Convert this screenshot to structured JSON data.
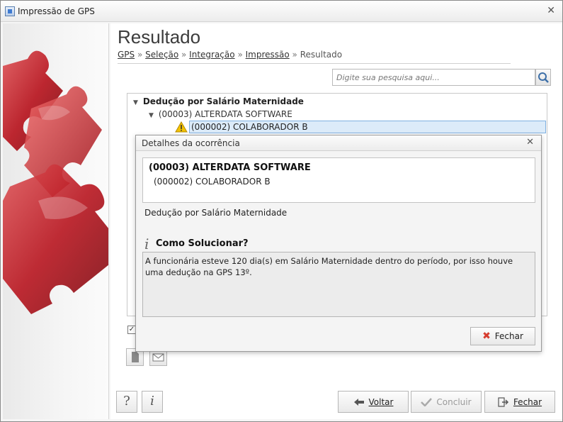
{
  "window": {
    "title": "Impressão de GPS",
    "close_glyph": "✕"
  },
  "header": {
    "title": "Resultado",
    "breadcrumb": [
      {
        "label": "GPS",
        "link": true
      },
      {
        "label": "Seleção",
        "link": true
      },
      {
        "label": "Integração",
        "link": true
      },
      {
        "label": "Impressão",
        "link": true
      },
      {
        "label": "Resultado",
        "link": false
      }
    ],
    "separator": "»"
  },
  "search": {
    "placeholder": "Digite sua pesquisa aqui...",
    "value": "",
    "icon": "search-icon"
  },
  "tree": {
    "group": "Dedução por Salário Maternidade",
    "company": "(00003) ALTERDATA SOFTWARE",
    "employee": "(000002) COLABORADOR B"
  },
  "dialog": {
    "title": "Detalhes da ocorrência",
    "company": "(00003) ALTERDATA SOFTWARE",
    "employee": "(000002) COLABORADOR B",
    "description": "Dedução por Salário Maternidade",
    "solve_title": "Como Solucionar?",
    "solve_text": "A funcionária esteve 120 dia(s) em Salário Maternidade dentro do período, por isso houve uma dedução na GPS 13º.",
    "close_button": "Fechar"
  },
  "footer": {
    "help": "?",
    "info": "i",
    "back": "Voltar",
    "finish": "Concluir",
    "close": "Fechar"
  },
  "colors": {
    "selection": "#dcebf9",
    "warning": "#f2c200",
    "close_x": "#d63c2e",
    "puzzle": "#c0202a"
  }
}
